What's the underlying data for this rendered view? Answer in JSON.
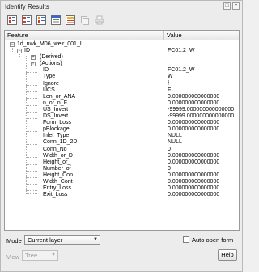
{
  "window": {
    "title": "Identify Results"
  },
  "toolbar": {
    "buttons": [
      {
        "icon": "expand-tree-icon"
      },
      {
        "icon": "collapse-tree-icon"
      },
      {
        "icon": "expand-new-icon"
      },
      {
        "icon": "open-form-icon"
      },
      {
        "icon": "clear-results-icon"
      },
      {
        "icon": "copy-feature-icon"
      },
      {
        "icon": "print-icon"
      }
    ]
  },
  "table": {
    "col_feature": "Feature",
    "col_value": "Value",
    "rows": [
      {
        "feature": "1d_nwk_M06_weir_001_L",
        "value": ""
      },
      {
        "feature": "ID",
        "value": "FC01.2_W"
      },
      {
        "feature": "(Derived)",
        "value": ""
      },
      {
        "feature": "(Actions)",
        "value": ""
      },
      {
        "feature": "ID",
        "value": "FC01.2_W"
      },
      {
        "feature": "Type",
        "value": "W"
      },
      {
        "feature": "Ignore",
        "value": "f"
      },
      {
        "feature": "UCS",
        "value": "F"
      },
      {
        "feature": "Len_or_ANA",
        "value": "0.000000000000000"
      },
      {
        "feature": "n_or_n_F",
        "value": "0.000000000000000"
      },
      {
        "feature": "US_Invert",
        "value": "-99999.000000000000000"
      },
      {
        "feature": "DS_Invert",
        "value": "-99999.000000000000000"
      },
      {
        "feature": "Form_Loss",
        "value": "0.000000000000000"
      },
      {
        "feature": "pBlockage",
        "value": "0.000000000000000"
      },
      {
        "feature": "Inlet_Type",
        "value": "NULL"
      },
      {
        "feature": "Conn_1D_2D",
        "value": "NULL"
      },
      {
        "feature": "Conn_No",
        "value": "0"
      },
      {
        "feature": "Width_or_D",
        "value": "0.000000000000000"
      },
      {
        "feature": "Height_or_",
        "value": "0.000000000000000"
      },
      {
        "feature": "Number_of",
        "value": "0"
      },
      {
        "feature": "Height_Con",
        "value": "0.000000000000000"
      },
      {
        "feature": "Width_Cont",
        "value": "0.000000000000000"
      },
      {
        "feature": "Entry_Loss",
        "value": "0.000000000000000"
      },
      {
        "feature": "Exit_Loss",
        "value": "0.000000000000000"
      }
    ]
  },
  "bottom": {
    "mode_label": "Mode",
    "mode_value": "Current layer",
    "auto_open_label": "Auto open form",
    "view_label": "View",
    "view_value": "Tree",
    "help_label": "Help"
  }
}
